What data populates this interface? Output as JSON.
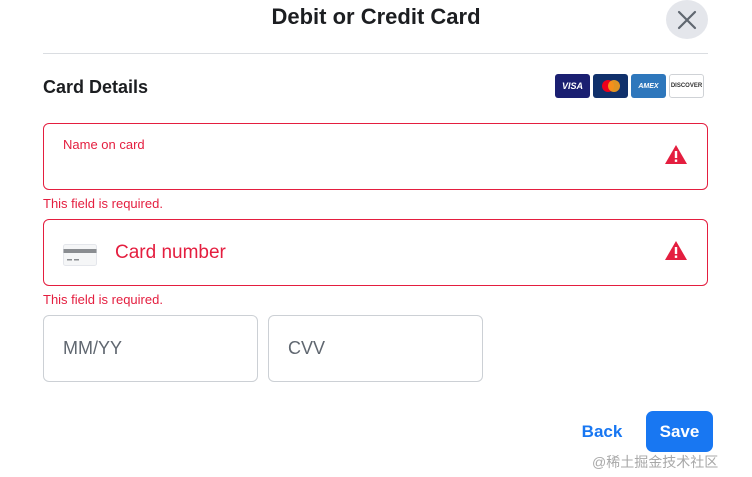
{
  "dialog": {
    "title": "Debit or Credit Card",
    "close_icon": "close-icon"
  },
  "section": {
    "title": "Card Details"
  },
  "card_logos": [
    {
      "name": "visa",
      "label": "VISA",
      "color": "#1a1f71"
    },
    {
      "name": "mastercard",
      "label": "",
      "color": "#10306b"
    },
    {
      "name": "amex",
      "label": "AMEX",
      "color": "#2e77bc"
    },
    {
      "name": "discover",
      "label": "DISCOVER",
      "color": "#ffffff"
    }
  ],
  "fields": {
    "name": {
      "label": "Name on card",
      "error": "This field is required.",
      "state": "error",
      "icon": "warning-icon"
    },
    "number": {
      "placeholder": "Card number",
      "error": "This field is required.",
      "state": "error",
      "icon": "credit-card-icon",
      "status_icon": "warning-icon"
    },
    "expiry": {
      "placeholder": "MM/YY"
    },
    "cvv": {
      "placeholder": "CVV"
    }
  },
  "actions": {
    "back_label": "Back",
    "save_label": "Save"
  },
  "colors": {
    "accent": "#1877f2",
    "error": "#e41e3f",
    "border": "#ccd0d5"
  },
  "watermark": "@稀土掘金技术社区"
}
